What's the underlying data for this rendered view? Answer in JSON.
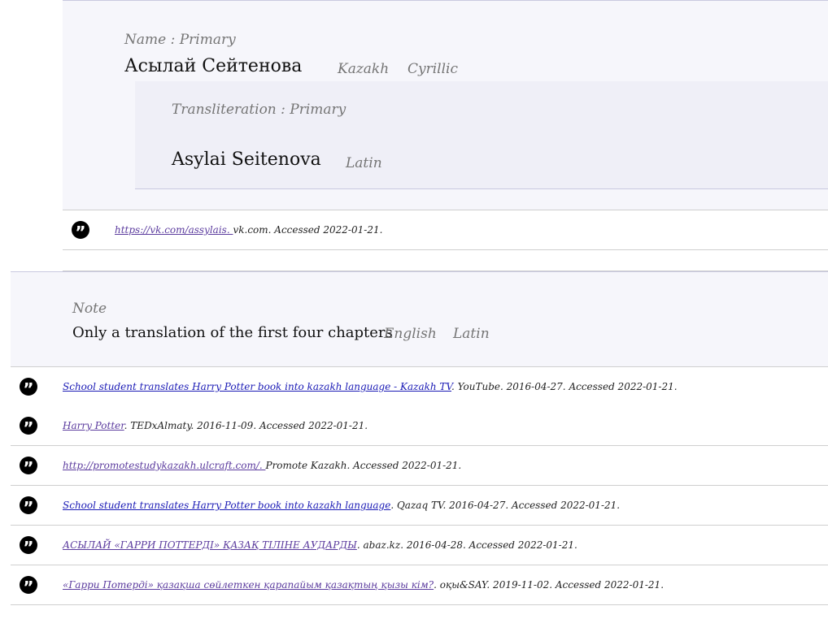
{
  "name": {
    "label": "Name : Primary",
    "value": "Асылай Сейтенова",
    "language": "Kazakh",
    "script": "Cyrillic"
  },
  "transliteration": {
    "label": "Transliteration : Primary",
    "value": "Asylai Seitenova",
    "script": "Latin"
  },
  "name_sources": [
    {
      "link": "https://vk.com/assylais. ",
      "rest": "vk.com. Accessed 2022-01-21."
    }
  ],
  "note": {
    "label": "Note",
    "value": "Only a translation of the first four chapters",
    "language": "English",
    "script": "Latin"
  },
  "note_sources": [
    {
      "link": "School student translates Harry Potter book into kazakh language - Kazakh TV",
      "rest": ". YouTube. 2016-04-27. Accessed 2022-01-21.",
      "link_color": "blue"
    },
    {
      "link": "Harry Potter",
      "rest": ". TEDxAlmaty. 2016-11-09. Accessed 2022-01-21.",
      "link_color": "purple"
    },
    {
      "link": "http://promotestudykazakh.ulcraft.com/. ",
      "rest": "Promote Kazakh. Accessed 2022-01-21.",
      "link_color": "purple"
    },
    {
      "link": "School student translates Harry Potter book into kazakh language",
      "rest": ". Qazaq TV. 2016-04-27. Accessed 2022-01-21.",
      "link_color": "blue"
    },
    {
      "link": "АСЫЛАЙ «ГАРРИ ПОТТЕРДІ» ҚАЗАҚ ТІЛІНЕ АУДАРДЫ",
      "rest": ". abaz.kz. 2016-04-28. Accessed 2022-01-21.",
      "link_color": "purple"
    },
    {
      "link": "«Гарри Потерді» қазақша сөйлеткен қарапайым қазақтың қызы кім?",
      "rest": ". оқы&SAY. 2019-11-02. Accessed 2022-01-21.",
      "link_color": "purple"
    }
  ],
  "icons": {
    "citation": "quote-icon"
  },
  "colors": {
    "link_visited": "#5b3b9e",
    "link": "#1a1ab5",
    "block_background": "#f6f6fb"
  }
}
